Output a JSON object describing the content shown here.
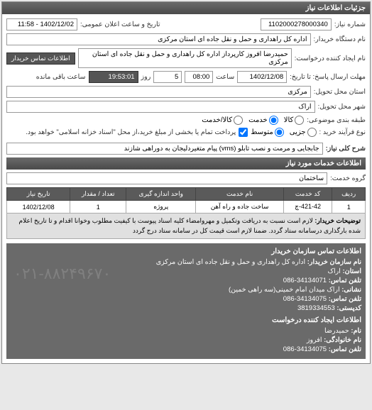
{
  "window_title": "جزئیات اطلاعات نیاز",
  "header": {
    "need_no_label": "شماره نیاز:",
    "need_no": "1102000278000340",
    "announce_label": "تاریخ و ساعت اعلان عمومی:",
    "announce_value": "1402/12/02 - 11:58",
    "buyer_org_label": "نام دستگاه خریدار:",
    "buyer_org": "اداره کل راهداری و حمل و نقل جاده ای استان مرکزی",
    "requester_label": "نام ایجاد کننده درخواست:",
    "requester": "حمیدرضا  افروز  کارپرداز اداره کل راهداری و حمل و نقل جاده ای استان مرکزی",
    "contact_btn": "اطلاعات تماس خریدار",
    "deadline_label": "مهلت ارسال پاسخ: تا تاریخ:",
    "deadline_date": "1402/12/08",
    "time_label": "ساعت",
    "deadline_time": "08:00",
    "days_label": "روز",
    "days_value": "5",
    "remain_label": "ساعت باقی مانده",
    "remain_time": "19:53:01",
    "delivery_province_label": "استان محل تحویل:",
    "delivery_province": "مرکزی",
    "delivery_city_label": "شهر محل تحویل:",
    "delivery_city": "اراک",
    "subject_group_label": "طبقه بندی موضوعی:",
    "opt_goods": "کالا",
    "opt_service": "خدمت",
    "opt_both": "کالا/خدمت",
    "process_type_label": "نوع فرآیند خرید :",
    "opt_small": "جزیی",
    "opt_medium": "متوسط",
    "process_note": "پرداخت تمام یا بخشی از مبلغ خرید،از محل \"اسناد خزانه اسلامی\" خواهد بود.",
    "need_title_label": "شرح کلی نیاز:",
    "need_title": "جابجایی و مرمت و نصب تابلو (vms) پیام متغیردلیجان به دوراهی شازند"
  },
  "services_section": "اطلاعات خدمات مورد نیاز",
  "service_group_label": "گروه خدمت:",
  "service_group": "ساختمان",
  "table": {
    "headers": {
      "row": "ردیف",
      "code": "کد خدمت",
      "name": "نام خدمت",
      "unit": "واحد اندازه گیری",
      "qty": "تعداد / مقدار",
      "date": "تاریخ نیاز"
    },
    "rows": [
      {
        "row": "1",
        "code": "421-42-چ",
        "name": "ساخت جاده و راه آهن",
        "unit": "پروژه",
        "qty": "1",
        "date": "1402/12/08"
      }
    ],
    "desc_label": "توضیحات خریدار:",
    "desc": "لازم است نسبت به دریافت وتکمیل و مهروامضاء کلیه اسناد پیوست با کیفیت مطلوب وخوانا اقدام و تا تاریخ اعلام شده بارگذاری درسامانه ستاد گردد. ضمنا لازم است قیمت کل در سامانه ستاد درج گردد"
  },
  "contact_buyer": {
    "title": "اطلاعات تماس سازمان خریدار",
    "org_label": "نام سازمان  خریدار:",
    "org": "اداره کل راهداری و حمل و نقل جاده ای استان مرکزی",
    "province_label": "استان:",
    "province": "اراک",
    "phone_label": "تلفن تماس:",
    "phone": "34134071-086",
    "addr_label": "نشانی:",
    "addr": "اراک میدان امام خمینی(سه راهی خمین)",
    "fax_label": "تلفن تماس:",
    "fax": "34134075-086",
    "post_label": "کدپستی:",
    "post": "3819334553"
  },
  "contact_requester": {
    "title": "اطلاعات ایجاد کننده درخواست",
    "fname_label": "نام:",
    "fname": "حمیدرضا",
    "lname_label": "نام خانوادگی:",
    "lname": "افروز",
    "phone_label": "تلفن تماس:",
    "phone": "34134075-086"
  },
  "watermark": "۰۲۱-۸۸۲۴۹۶۷۰"
}
